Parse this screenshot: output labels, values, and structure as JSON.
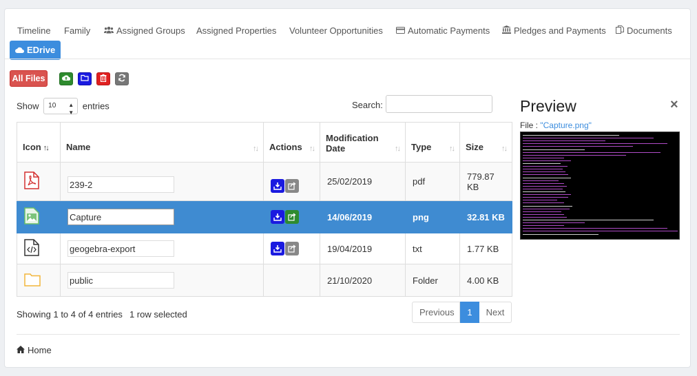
{
  "tabs": [
    {
      "label": "Timeline",
      "icon": ""
    },
    {
      "label": "Family",
      "icon": ""
    },
    {
      "label": "Assigned Groups",
      "icon": "users-icon"
    },
    {
      "label": "Assigned Properties",
      "icon": ""
    },
    {
      "label": "Volunteer Opportunities",
      "icon": ""
    },
    {
      "label": "Automatic Payments",
      "icon": "credit-card-icon"
    },
    {
      "label": "Pledges and Payments",
      "icon": "bank-icon"
    },
    {
      "label": "Documents",
      "icon": "copy-icon"
    },
    {
      "label": "EDrive",
      "icon": "cloud-icon",
      "active": true
    }
  ],
  "toolbar": {
    "all_files_label": "All Files",
    "buttons": [
      {
        "name": "upload",
        "color": "#28a745",
        "icon": "cloud-upload-icon"
      },
      {
        "name": "new-folder",
        "color": "#1a1ae0",
        "icon": "folder-icon"
      },
      {
        "name": "delete",
        "color": "#e02020",
        "icon": "trash-icon"
      },
      {
        "name": "refresh",
        "color": "#777777",
        "icon": "refresh-icon"
      }
    ]
  },
  "length": {
    "show": "Show",
    "value": "10",
    "entries": "entries"
  },
  "search": {
    "label": "Search:",
    "value": ""
  },
  "table": {
    "headers": [
      "Icon",
      "Name",
      "Actions",
      "Modification Date",
      "Type",
      "Size"
    ],
    "rows": [
      {
        "icon": "pdf-file-icon",
        "name": "239-2",
        "date": "25/02/2019",
        "type": "pdf",
        "size": "779.87 KB",
        "actions": true
      },
      {
        "icon": "image-file-icon",
        "name": "Capture",
        "date": "14/06/2019",
        "type": "png",
        "size": "32.81 KB",
        "actions": true,
        "selected": true
      },
      {
        "icon": "code-file-icon",
        "name": "geogebra-export",
        "date": "19/04/2019",
        "type": "txt",
        "size": "1.77 KB",
        "actions": true
      },
      {
        "icon": "folder-icon",
        "name": "public",
        "date": "21/10/2020",
        "type": "Folder",
        "size": "4.00 KB",
        "actions": false
      }
    ]
  },
  "info": {
    "showing": "Showing 1 to 4 of 4 entries",
    "selected": "1 row selected"
  },
  "pager": {
    "previous": "Previous",
    "current": "1",
    "next": "Next"
  },
  "footer": {
    "home": "Home"
  },
  "preview": {
    "title": "Preview",
    "file_prefix": "File : ",
    "file_name": "\"Capture.png\""
  },
  "colors": {
    "accent": "#3c8dde",
    "danger": "#d9534f",
    "selected_row": "#3f8bd1"
  }
}
